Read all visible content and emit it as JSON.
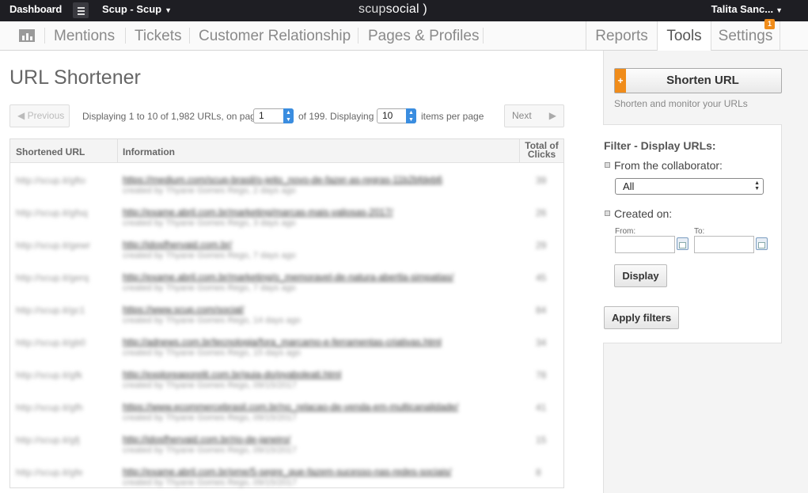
{
  "topbar": {
    "dashboard": "Dashboard",
    "account": "Scup - Scup",
    "logo_light": "scup",
    "logo_bold": "social",
    "logo_mark": ")",
    "user": "Talita Sanc..."
  },
  "nav": {
    "items": [
      "Mentions",
      "Tickets",
      "Customer Relationship",
      "Pages & Profiles"
    ],
    "right": [
      "Reports",
      "Tools",
      "Settings"
    ],
    "active": "Tools",
    "settings_badge": "1"
  },
  "page": {
    "title": "URL Shortener"
  },
  "pager": {
    "previous": "Previous",
    "next": "Next",
    "displaying": "Displaying 1 to 10 of 1,982 URLs, on page",
    "page_value": "1",
    "of_pages": "of 199. Displaying",
    "per_page_value": "10",
    "per_page_suffix": "items per page"
  },
  "table": {
    "headers": [
      "Shortened URL",
      "Information",
      "Total of Clicks"
    ],
    "rows": [
      {
        "short": "http://scup.it/gfto",
        "url": "https://medium.com/scup-brasil/o-jeito_novo-de-fazer-as-regras-11b2bfdeb6",
        "sub": "created by Thyane Gomes Rego, 2 days ago",
        "clicks": "39"
      },
      {
        "short": "http://scup.it/gfsq",
        "url": "http://exame.abril.com.br/marketing/marcas-mais-valiosas-2017/",
        "sub": "created by Thyane Gomes Rego, 3 days ago",
        "clicks": "26"
      },
      {
        "short": "http://scup.it/gewr",
        "url": "http://idosfhervaid.com.br/",
        "sub": "created by Thyane Gomes Rego, 7 days ago",
        "clicks": "29"
      },
      {
        "short": "http://scup.it/gerq",
        "url": "http://exame.abril.com.br/marketing/o_memoravel-de-natura-abertla-simpatias/",
        "sub": "created by Thyane Gomes Rego, 7 days ago",
        "clicks": "45"
      },
      {
        "short": "http://scup.it/gc1",
        "url": "https://www.scup.com/social/",
        "sub": "created by Thyane Gomes Rego, 14 days ago",
        "clicks": "84"
      },
      {
        "short": "http://scup.it/gb0",
        "url": "http://adnews.com.br/tecnologia/fora_marcamo-e-ferramentas-criativas.html",
        "sub": "created by Thyane Gomes Rego, 15 days ago",
        "clicks": "34"
      },
      {
        "short": "http://scup.it/gfk",
        "url": "http://exploreaporelit.com.br/guia-do/pyaboleati.html",
        "sub": "created by Thyane Gomes Rego, 09/15/2017",
        "clicks": "78"
      },
      {
        "short": "http://scup.it/gfh",
        "url": "https://www.ecommercebrasil.com.br/no_relacao-de-venda-em-multicanalidade/",
        "sub": "created by Thyane Gomes Rego, 09/15/2017",
        "clicks": "41"
      },
      {
        "short": "http://scup.it/gfj",
        "url": "http://idosfhervaid.com.br/rio-de-janeiro/",
        "sub": "created by Thyane Gomes Rego, 09/15/2017",
        "clicks": "15"
      },
      {
        "short": "http://scup.it/gfe",
        "url": "http://exame.abril.com.br/pme/5-segre_que-fazem-sucesso-nas-redes-sociais/",
        "sub": "created by Thyane Gomes Rego, 09/15/2017",
        "clicks": "8"
      }
    ]
  },
  "sidebar": {
    "shorten_button": "Shorten URL",
    "shorten_plus": "+",
    "shorten_sub": "Shorten and monitor your URLs",
    "filter_title": "Filter - Display URLs:",
    "collaborator_label": "From the collaborator:",
    "collaborator_value": "All",
    "created_label": "Created on:",
    "from_label": "From:",
    "to_label": "To:",
    "display_button": "Display",
    "apply_button": "Apply filters"
  },
  "icons": [
    "menu-icon",
    "chart-icon",
    "caret-down-icon",
    "prev-arrow-icon",
    "next-arrow-icon",
    "calendar-icon",
    "spinner-arrows-icon"
  ],
  "colors": {
    "accent": "#f08c1a",
    "topbar": "#1e1e23",
    "spinner": "#3a8de0"
  }
}
